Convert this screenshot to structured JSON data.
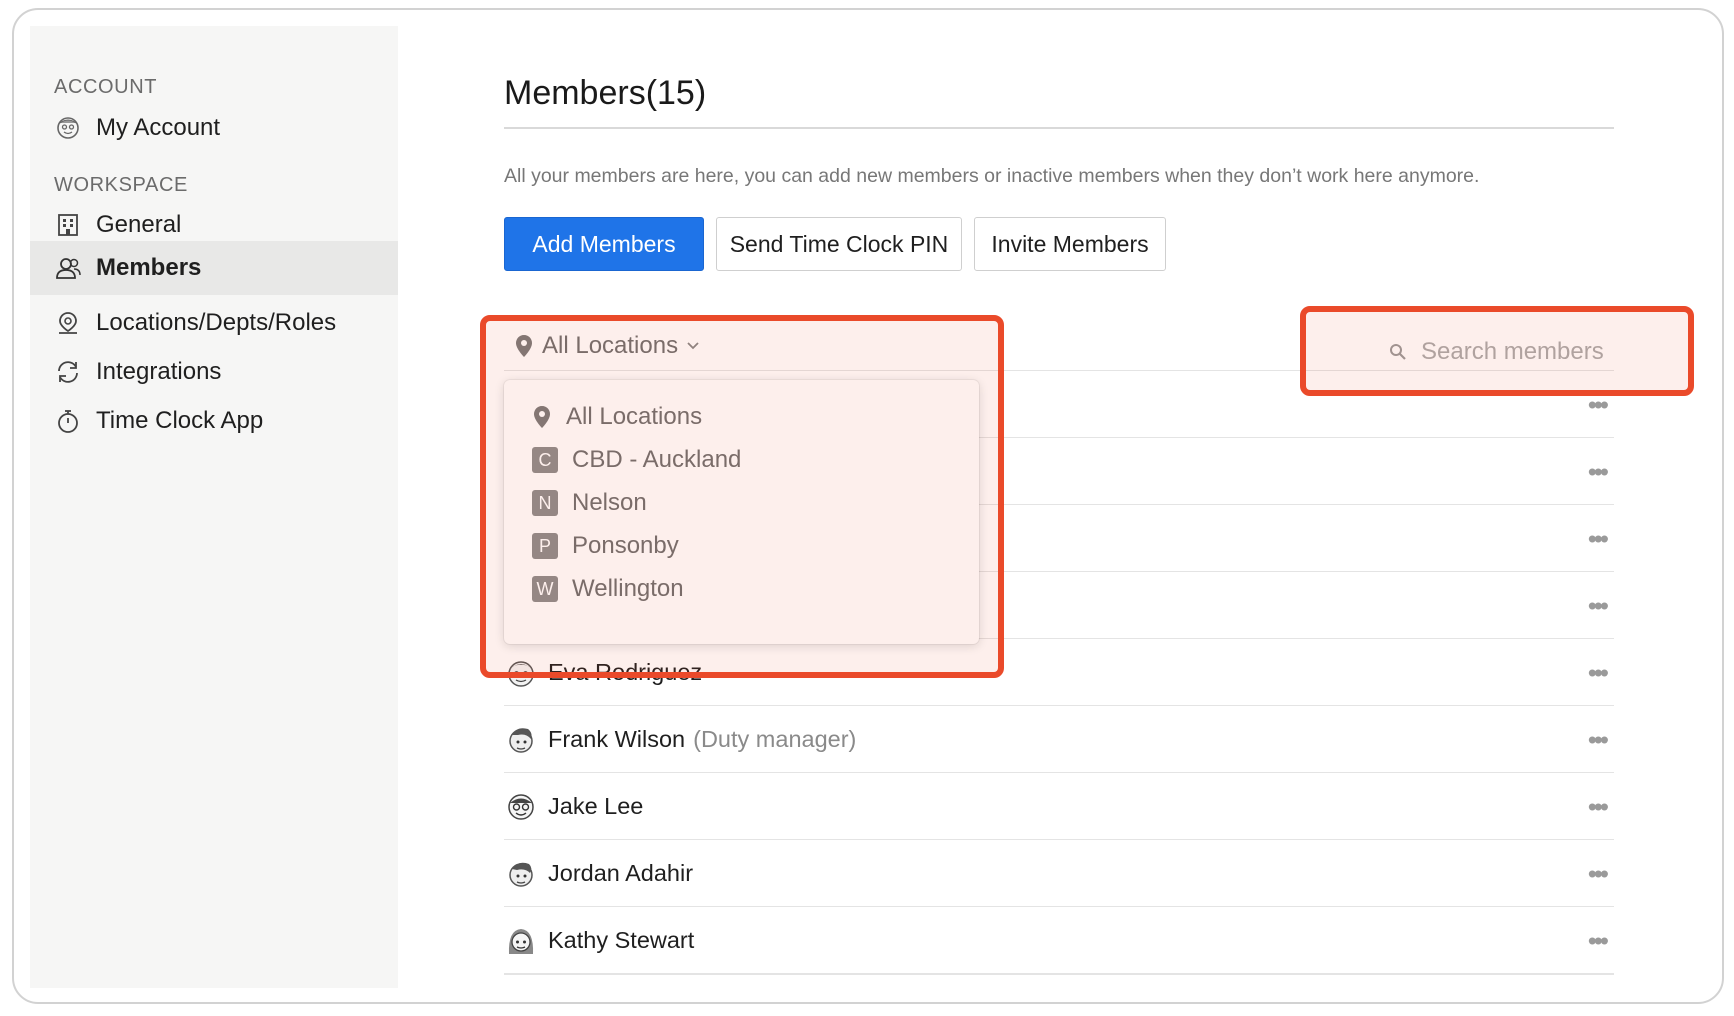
{
  "sidebar": {
    "account_label": "ACCOUNT",
    "workspace_label": "WORKSPACE",
    "items": [
      {
        "label": "My Account",
        "icon": "account-avatar-icon"
      },
      {
        "label": "General",
        "icon": "building-icon"
      },
      {
        "label": "Members",
        "icon": "members-icon",
        "active": true
      },
      {
        "label": "Locations/Depts/Roles",
        "icon": "location-pin-icon"
      },
      {
        "label": "Integrations",
        "icon": "sync-icon"
      },
      {
        "label": "Time Clock App",
        "icon": "stopwatch-icon"
      }
    ]
  },
  "main": {
    "title": "Members(15)",
    "description": "All your members are here, you can add new members or inactive members when they don’t work here anymore.",
    "buttons": {
      "add": "Add Members",
      "send_pin": "Send Time Clock PIN",
      "invite": "Invite Members"
    },
    "location_filter": {
      "selected": "All Locations",
      "options": [
        {
          "label": "All Locations",
          "badge": ""
        },
        {
          "label": "CBD - Auckland",
          "badge": "C"
        },
        {
          "label": "Nelson",
          "badge": "N"
        },
        {
          "label": "Ponsonby",
          "badge": "P"
        },
        {
          "label": "Wellington",
          "badge": "W"
        }
      ]
    },
    "search": {
      "placeholder": "Search members",
      "value": ""
    },
    "members": [
      {
        "name": "Eva Rodriguez",
        "role": ""
      },
      {
        "name": "Frank Wilson",
        "role": "(Duty manager)"
      },
      {
        "name": "Jake Lee",
        "role": ""
      },
      {
        "name": "Jordan Adahir",
        "role": ""
      },
      {
        "name": "Kathy Stewart",
        "role": ""
      }
    ],
    "row_menu_glyph": "•••"
  },
  "colors": {
    "accent": "#1f74e8",
    "highlight": "#ea4a2a"
  }
}
